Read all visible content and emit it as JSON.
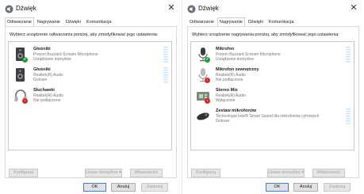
{
  "left": {
    "window_title": "Dźwięk",
    "close_label": "✕",
    "tabs": [
      {
        "label": "Odtwarzanie",
        "active": true
      },
      {
        "label": "Nagrywanie",
        "active": false
      },
      {
        "label": "Dźwięki",
        "active": false
      },
      {
        "label": "Komunikacja",
        "active": false
      }
    ],
    "instruction": "Wybierz urządzenie odtwarzania poniżej, aby zmodyfikować jego ustawienia:",
    "devices": [
      {
        "name": "Głośniki",
        "subtitle": "Preyon Buzzard Scream Microphone",
        "status": "Urządzenie domyślne",
        "icon": "speaker-icon",
        "badge": "ok"
      },
      {
        "name": "Głośniki",
        "subtitle": "Realtek(R) Audio",
        "status": "Gotowe",
        "icon": "speaker-icon",
        "badge": ""
      },
      {
        "name": "Słuchawki",
        "subtitle": "Realtek(R) Audio",
        "status": "Nie podłączone",
        "icon": "headphones-icon",
        "badge": "down"
      }
    ],
    "buttons": {
      "configure": "Konfiguruj",
      "set_default": "Ustaw domyślne ▾",
      "properties": "Właściwości",
      "ok": "OK",
      "cancel": "Anuluj",
      "apply": "Zastosuj"
    }
  },
  "right": {
    "window_title": "Dźwięk",
    "close_label": "✕",
    "tabs": [
      {
        "label": "Odtwarzanie",
        "active": false
      },
      {
        "label": "Nagrywanie",
        "active": true
      },
      {
        "label": "Dźwięki",
        "active": false
      },
      {
        "label": "Komunikacja",
        "active": false
      }
    ],
    "instruction": "Wybierz urządzenie nagrywania poniżej, aby zmodyfikować jego ustawienia:",
    "devices": [
      {
        "name": "Mikrofon",
        "subtitle": "Preyon Buzzard Scream Microphone",
        "status": "Urządzenie domyślne",
        "icon": "microphone-icon",
        "badge": "ok"
      },
      {
        "name": "Mikrofon zewnętrzny",
        "subtitle": "Realtek(R) Audio",
        "status": "Nie podłączone",
        "icon": "microphone-icon",
        "badge": "down"
      },
      {
        "name": "Stereo Mix",
        "subtitle": "Realtek(R) Audio",
        "status": "Wyłączone",
        "icon": "circuit-board-icon",
        "badge": "down"
      },
      {
        "name": "Zestaw mikrofonów",
        "subtitle": "Technologia Intel® Smart Sound dla mikrofonów cyfrowych",
        "status": "Gotowe",
        "icon": "microphone-array-icon",
        "badge": ""
      }
    ],
    "buttons": {
      "configure": "Konfiguruj",
      "set_default": "Ustaw domyślne ▾",
      "properties": "Właściwości",
      "ok": "OK",
      "cancel": "Anuluj",
      "apply": "Zastosuj"
    }
  }
}
